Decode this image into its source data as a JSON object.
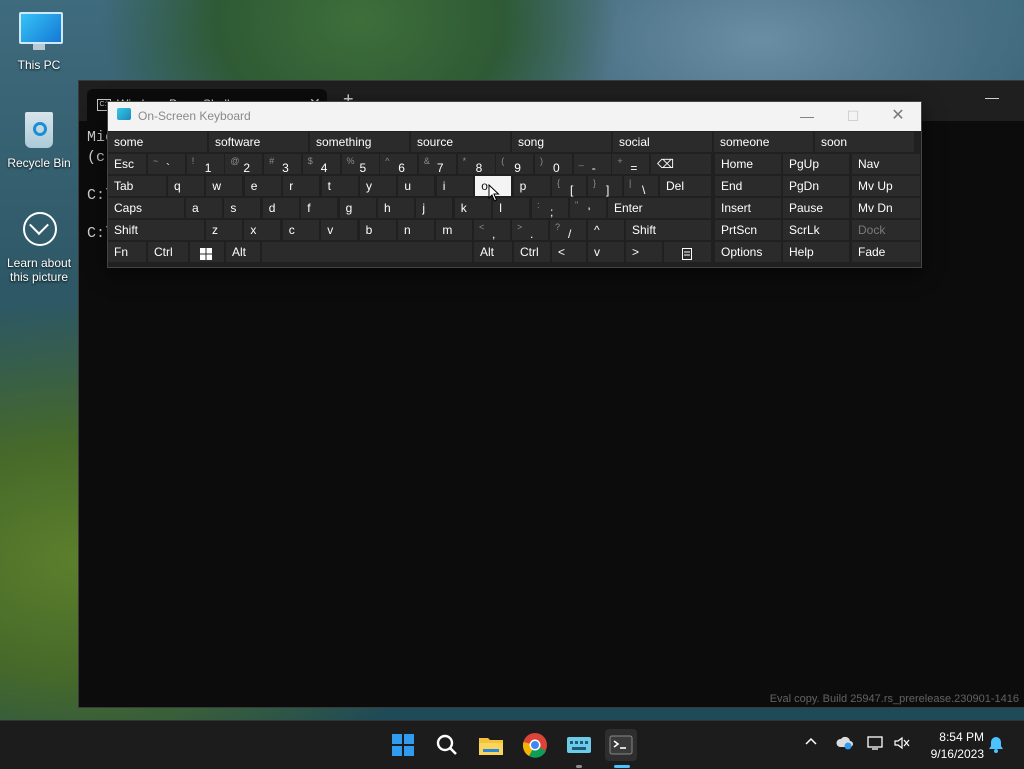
{
  "desktop": {
    "icons": [
      {
        "label": "This PC",
        "icon": "computer-icon"
      },
      {
        "label": "Recycle Bin",
        "icon": "recycle-bin-icon"
      },
      {
        "label": "Learn about\nthis picture",
        "icon": "learn-picture-icon"
      }
    ]
  },
  "terminal": {
    "tab_title": "Windows PowerShell",
    "new_tab": "+",
    "lines": [
      "Mic",
      "(c)",
      "C:\\",
      "C:\\"
    ],
    "watermark": "Eval copy. Build 25947.rs_prerelease.230901-1416"
  },
  "osk": {
    "title": "On-Screen Keyboard",
    "controls": {
      "minimize": "—",
      "maximize": "☐",
      "close": "✕"
    },
    "predictions": [
      "some",
      "software",
      "something",
      "source",
      "song",
      "social",
      "someone",
      "soon"
    ],
    "row1": {
      "esc": "Esc",
      "keys": [
        {
          "s": "~",
          "m": "`"
        },
        {
          "s": "!",
          "m": "1"
        },
        {
          "s": "@",
          "m": "2"
        },
        {
          "s": "#",
          "m": "3"
        },
        {
          "s": "$",
          "m": "4"
        },
        {
          "s": "%",
          "m": "5"
        },
        {
          "s": "^",
          "m": "6"
        },
        {
          "s": "&",
          "m": "7"
        },
        {
          "s": "*",
          "m": "8"
        },
        {
          "s": "(",
          "m": "9"
        },
        {
          "s": ")",
          "m": "0"
        },
        {
          "s": "_",
          "m": "-"
        },
        {
          "s": "+",
          "m": "="
        }
      ],
      "backspace": "⌫"
    },
    "row2": {
      "tab": "Tab",
      "letters": [
        "q",
        "w",
        "e",
        "r",
        "t",
        "y",
        "u",
        "i",
        "o",
        "p"
      ],
      "brackets": [
        {
          "s": "{",
          "m": "["
        },
        {
          "s": "}",
          "m": "]"
        },
        {
          "s": "|",
          "m": "\\"
        }
      ],
      "del": "Del"
    },
    "row3": {
      "caps": "Caps",
      "letters": [
        "a",
        "s",
        "d",
        "f",
        "g",
        "h",
        "j",
        "k",
        "l"
      ],
      "punct": [
        {
          "s": ":",
          "m": ";"
        },
        {
          "s": "\"",
          "m": "'"
        }
      ],
      "enter": "Enter"
    },
    "row4": {
      "shift": "Shift",
      "letters": [
        "z",
        "x",
        "c",
        "v",
        "b",
        "n",
        "m"
      ],
      "punct": [
        {
          "s": "<",
          "m": ","
        },
        {
          "s": ">",
          "m": "."
        },
        {
          "s": "?",
          "m": "/"
        }
      ],
      "up": "^",
      "shift_r": "Shift"
    },
    "row5": {
      "fn": "Fn",
      "ctrl": "Ctrl",
      "alt": "Alt",
      "alt_r": "Alt",
      "ctrl_r": "Ctrl",
      "left": "<",
      "down": "v",
      "right": ">"
    },
    "nav": [
      [
        "Home",
        "PgUp",
        "Nav"
      ],
      [
        "End",
        "PgDn",
        "Mv Up"
      ],
      [
        "Insert",
        "Pause",
        "Mv Dn"
      ],
      [
        "PrtScn",
        "ScrLk",
        "Dock"
      ],
      [
        "Options",
        "Help",
        "Fade"
      ]
    ],
    "active_key": "o"
  },
  "taskbar": {
    "time": "8:54 PM",
    "date": "9/16/2023",
    "pinned": [
      "start-icon",
      "search-icon",
      "file-explorer-icon",
      "chrome-icon",
      "on-screen-keyboard-icon",
      "terminal-icon"
    ]
  }
}
